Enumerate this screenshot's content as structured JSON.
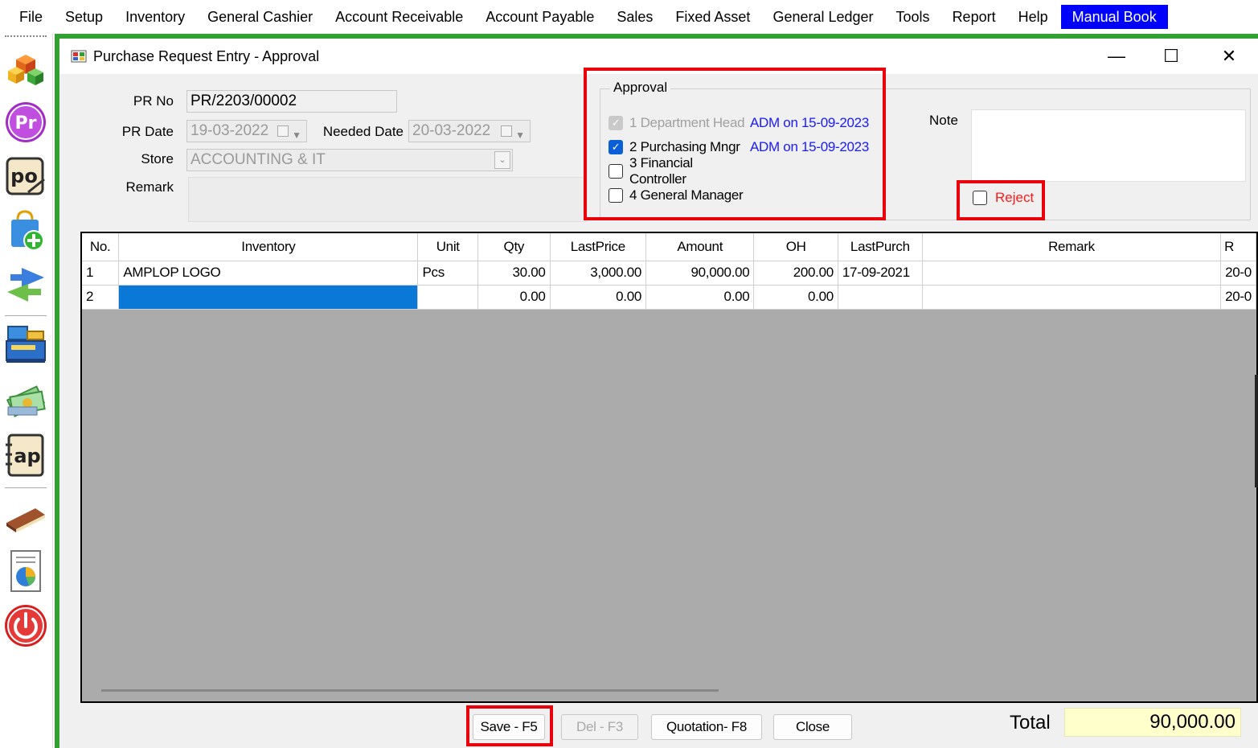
{
  "menu": {
    "items": [
      "File",
      "Setup",
      "Inventory",
      "General Cashier",
      "Account Receivable",
      "Account Payable",
      "Sales",
      "Fixed Asset",
      "General Ledger",
      "Tools",
      "Report",
      "Help"
    ],
    "manual_book": "Manual Book"
  },
  "toolbar": {
    "icons": [
      "cube-stack-icon",
      "pr-icon",
      "po-icon",
      "shopping-bag-add-icon",
      "transfer-arrows-icon",
      "cash-register-icon",
      "money-icon",
      "ap-icon",
      "ledger-book-icon",
      "report-chart-icon",
      "power-icon"
    ],
    "pr_glyph": "Pr",
    "po_glyph": "po",
    "ap_glyph": "ap"
  },
  "window": {
    "title": "Purchase Request Entry - Approval",
    "minimize": "—",
    "maximize": "☐",
    "close": "✕"
  },
  "form": {
    "pr_no_label": "PR No",
    "pr_no": "PR/2203/00002",
    "pr_date_label": "PR Date",
    "pr_date": "19-03-2022",
    "needed_date_label": "Needed Date",
    "needed_date": "20-03-2022",
    "store_label": "Store",
    "store": "ACCOUNTING & IT",
    "remark_label": "Remark"
  },
  "approval": {
    "legend": "Approval",
    "levels": [
      {
        "label": "1 Department Head",
        "checked": true,
        "disabled": true,
        "approver": "ADM on 15-09-2023"
      },
      {
        "label": "2 Purchasing Mngr",
        "checked": true,
        "disabled": false,
        "approver": "ADM on 15-09-2023"
      },
      {
        "label": "3 Financial Controller",
        "checked": false,
        "disabled": false,
        "approver": ""
      },
      {
        "label": "4 General Manager",
        "checked": false,
        "disabled": false,
        "approver": ""
      }
    ],
    "note_label": "Note",
    "reject_label": "Reject"
  },
  "grid": {
    "columns": [
      "No.",
      "Inventory",
      "Unit",
      "Qty",
      "LastPrice",
      "Amount",
      "OH",
      "LastPurch",
      "Remark",
      "R"
    ],
    "rows": [
      [
        "1",
        "AMPLOP LOGO",
        "Pcs",
        "30.00",
        "3,000.00",
        "90,000.00",
        "200.00",
        "17-09-2021",
        "",
        "20-0"
      ],
      [
        "2",
        "",
        "",
        "0.00",
        "0.00",
        "0.00",
        "0.00",
        "",
        "",
        "20-0"
      ]
    ]
  },
  "buttons": {
    "save": "Save - F5",
    "delete": "Del - F3",
    "quotation": "Quotation- F8",
    "close": "Close"
  },
  "total": {
    "label": "Total",
    "value": "90,000.00"
  },
  "colors": {
    "highlight": "#e8000b",
    "accent": "#0000ff",
    "frame": "#33a033",
    "selection": "#0a78d7"
  }
}
